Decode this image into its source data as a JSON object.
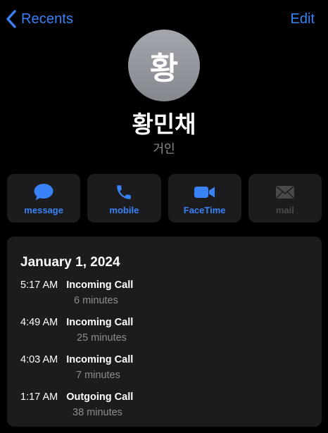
{
  "nav": {
    "back_label": "Recents",
    "edit_label": "Edit"
  },
  "contact": {
    "initial": "황",
    "name": "황민채",
    "subtitle": "거인"
  },
  "actions": [
    {
      "label": "message",
      "icon": "message-bubble-icon",
      "enabled": true
    },
    {
      "label": "mobile",
      "icon": "phone-icon",
      "enabled": true
    },
    {
      "label": "FaceTime",
      "icon": "video-camera-icon",
      "enabled": true
    },
    {
      "label": "mail",
      "icon": "envelope-icon",
      "enabled": false
    }
  ],
  "history": {
    "date": "January 1, 2024",
    "calls": [
      {
        "time": "5:17 AM",
        "type": "Incoming Call",
        "duration": "6 minutes"
      },
      {
        "time": "4:49 AM",
        "type": "Incoming Call",
        "duration": "25 minutes"
      },
      {
        "time": "4:03 AM",
        "type": "Incoming Call",
        "duration": "7 minutes"
      },
      {
        "time": "1:17 AM",
        "type": "Outgoing Call",
        "duration": "38 minutes"
      }
    ]
  },
  "colors": {
    "accent": "#3a82f7",
    "background": "#000000",
    "card": "#1c1c1e",
    "secondary_text": "#8d8d92",
    "disabled": "#4a4a4d",
    "avatar": "#8e9197"
  }
}
